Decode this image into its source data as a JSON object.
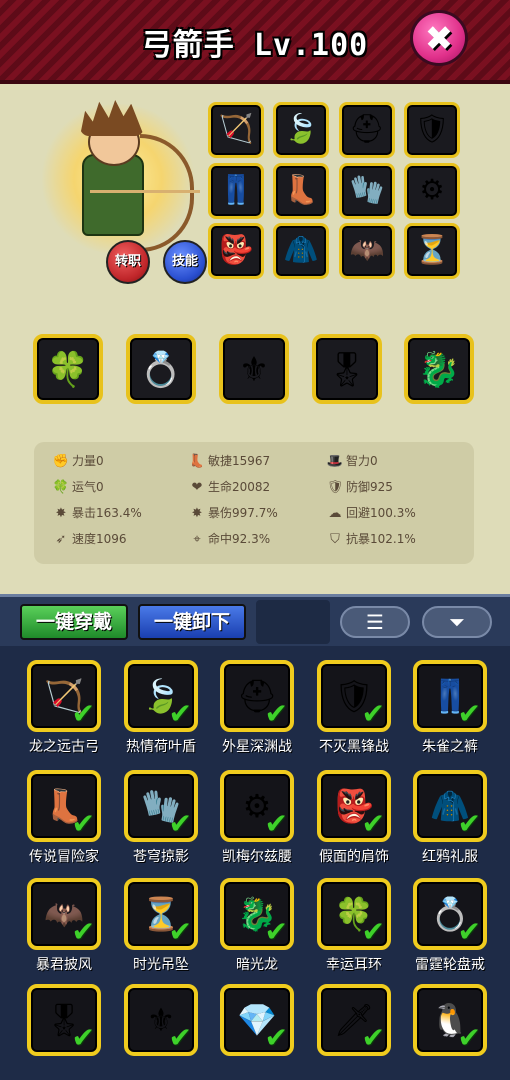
{
  "header": {
    "title": "弓箭手 Lv.100",
    "close_icon": "✖"
  },
  "hero": {
    "class_button": "转职",
    "skill_button": "技能"
  },
  "equipped_slots": [
    {
      "name": "bow-icon",
      "glyph": "🏹"
    },
    {
      "name": "leaf-shield-icon",
      "glyph": "🍃"
    },
    {
      "name": "helmet-icon",
      "glyph": "⛑"
    },
    {
      "name": "armor-icon",
      "glyph": "🛡"
    },
    {
      "name": "pants-icon",
      "glyph": "👖"
    },
    {
      "name": "boots-icon",
      "glyph": "👢"
    },
    {
      "name": "gauntlet-icon",
      "glyph": "🧤"
    },
    {
      "name": "belt-icon",
      "glyph": "⚙"
    },
    {
      "name": "mask-icon",
      "glyph": "👺"
    },
    {
      "name": "robe-icon",
      "glyph": "🧥"
    },
    {
      "name": "cape-icon",
      "glyph": "🦇"
    },
    {
      "name": "hourglass-pendant-icon",
      "glyph": "⏳"
    }
  ],
  "accessory_slots": [
    {
      "name": "clover-earring-icon",
      "glyph": "🍀"
    },
    {
      "name": "ring-icon",
      "glyph": "💍"
    },
    {
      "name": "emblem-icon",
      "glyph": "⚜"
    },
    {
      "name": "medal-icon",
      "glyph": "🎖"
    },
    {
      "name": "dragon-pet-icon",
      "glyph": "🐉"
    }
  ],
  "stats": [
    {
      "glyph": "✊",
      "text": "力量0"
    },
    {
      "glyph": "👢",
      "text": "敏捷15967"
    },
    {
      "glyph": "🎩",
      "text": "智力0"
    },
    {
      "glyph": "🍀",
      "text": "运气0"
    },
    {
      "glyph": "❤",
      "text": "生命20082"
    },
    {
      "glyph": "🛡",
      "text": "防御925"
    },
    {
      "glyph": "✸",
      "text": "暴击163.4%"
    },
    {
      "glyph": "✸",
      "text": "暴伤997.7%"
    },
    {
      "glyph": "☁",
      "text": "回避100.3%"
    },
    {
      "glyph": "➶",
      "text": "速度1096"
    },
    {
      "glyph": "⌖",
      "text": "命中92.3%"
    },
    {
      "glyph": "⛉",
      "text": "抗暴102.1%"
    }
  ],
  "inventory": {
    "equip_all": "一键穿戴",
    "unequip_all": "一键卸下",
    "list_icon": "☰",
    "filter_icon": "⏷",
    "check_glyph": "✔",
    "items": [
      {
        "name": "龙之远古弓",
        "glyph": "🏹"
      },
      {
        "name": "热情荷叶盾",
        "glyph": "🍃"
      },
      {
        "name": "外星深渊战",
        "glyph": "⛑"
      },
      {
        "name": "不灭黑锋战",
        "glyph": "🛡"
      },
      {
        "name": "朱雀之裤",
        "glyph": "👖"
      },
      {
        "name": "传说冒险家",
        "glyph": "👢"
      },
      {
        "name": "苍穹掠影",
        "glyph": "🧤"
      },
      {
        "name": "凯梅尔兹腰",
        "glyph": "⚙"
      },
      {
        "name": "假面的肩饰",
        "glyph": "👺"
      },
      {
        "name": "红鸦礼服",
        "glyph": "🧥"
      },
      {
        "name": "暴君披风",
        "glyph": "🦇"
      },
      {
        "name": "时光吊坠",
        "glyph": "⏳"
      },
      {
        "name": "暗光龙",
        "glyph": "🐉"
      },
      {
        "name": "幸运耳环",
        "glyph": "🍀"
      },
      {
        "name": "雷霆轮盘戒",
        "glyph": "💍"
      },
      {
        "name": "",
        "glyph": "🎖"
      },
      {
        "name": "",
        "glyph": "⚜"
      },
      {
        "name": "",
        "glyph": "💎"
      },
      {
        "name": "",
        "glyph": "🗡"
      },
      {
        "name": "",
        "glyph": "🐧"
      }
    ]
  }
}
